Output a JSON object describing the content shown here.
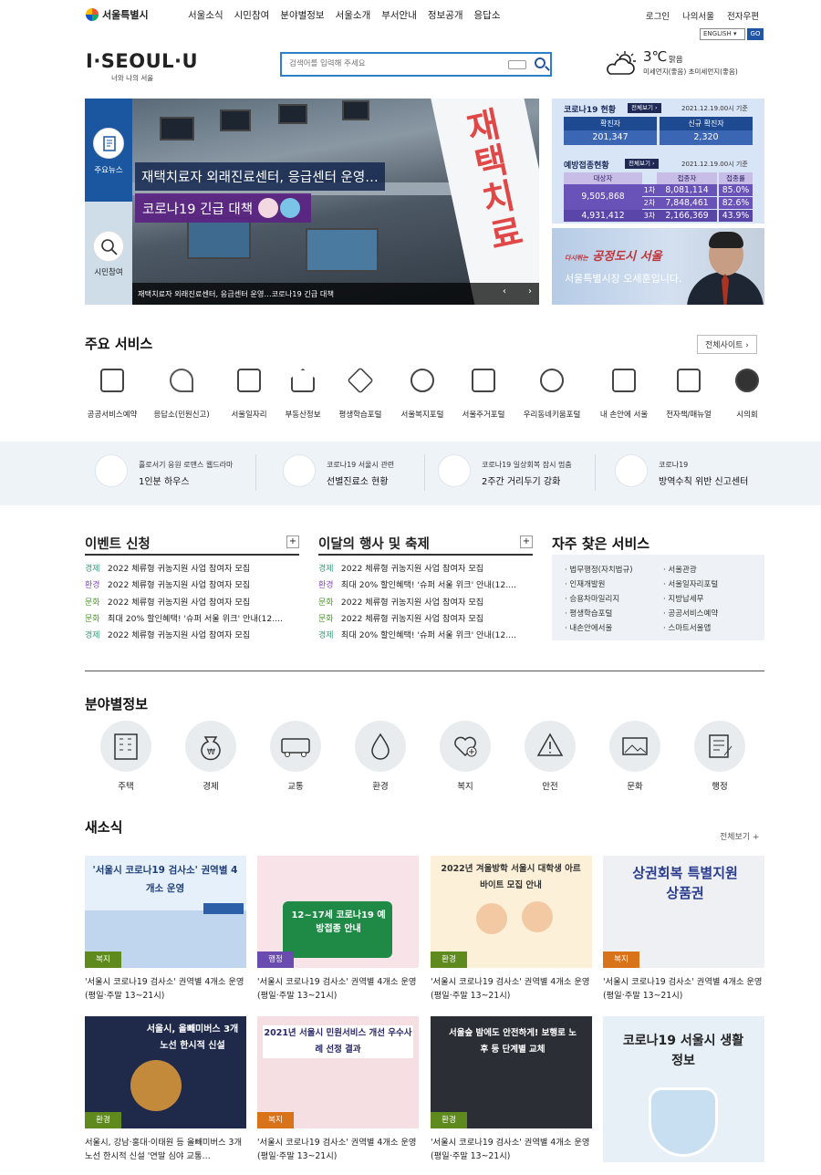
{
  "header": {
    "org_name": "서울특별시",
    "gnb": [
      "서울소식",
      "시민참여",
      "분야별정보",
      "서울소개",
      "부서안내",
      "정보공개",
      "응답소"
    ],
    "util": [
      "로그인",
      "나의서울",
      "전자우편"
    ],
    "language": "ENGLISH",
    "go_label": "GO",
    "brand": "I·SEOUL·U",
    "brand_sub": "너와 나의 서울",
    "search_placeholder": "검색어를 입력해 주세요",
    "weather": {
      "temp": "3℃",
      "desc": "맑음",
      "dust": "미세먼지(좋음) 초미세먼지(좋음)"
    }
  },
  "hero": {
    "side_news": "주요뉴스",
    "side_participation": "시민참여",
    "banner_text": "재택치료",
    "title1": "재택치료자 외래진료센터, 응급센터 운영…",
    "title2": "코로나19 긴급 대책",
    "caption": "재택치료자 외래진료센터, 응급센터 운영…코로나19 긴급 대책",
    "prev": "‹",
    "next": "›"
  },
  "covid": {
    "title": "코로나19 현황",
    "view_all": "전체보기 ›",
    "date": "2021.12.19.00시 기준",
    "confirmed_label": "확진자",
    "confirmed": "201,347",
    "new_label": "신규 확진자",
    "new_confirmed": "2,320",
    "vax_title": "예방접종현황",
    "vax_view_all": "전체보기 ›",
    "vax_date": "2021.12.19.00시 기준",
    "vax_headers": [
      "대상자",
      "접종자",
      "접종률"
    ],
    "target_1": "9,505,868",
    "target_2": "4,931,412",
    "rows": [
      {
        "dose": "1차",
        "count": "8,081,114",
        "rate": "85.0%"
      },
      {
        "dose": "2차",
        "count": "7,848,461",
        "rate": "82.6%"
      },
      {
        "dose": "3차",
        "count": "2,166,369",
        "rate": "43.9%"
      }
    ]
  },
  "mayor": {
    "slogan_small": "다시뛰는",
    "slogan": "공정도시 서울",
    "intro": "서울특별시장 오세훈입니다."
  },
  "services": {
    "title": "주요 서비스",
    "all_sites": "전체사이트 ›",
    "items": [
      "공공서비스예약",
      "응답소(민원신고)",
      "서울일자리",
      "부동산정보",
      "평생학습포털",
      "서울복지포털",
      "서울주거포털",
      "우리동네키움포털",
      "내 손안에 서울",
      "전자책/매뉴얼",
      "시의회"
    ]
  },
  "strip": [
    {
      "l1": "흘로서기 응원 로맨스 웹드라마",
      "l2": "1인분 하우스"
    },
    {
      "l1": "코로나19 서울시 관련",
      "l2": "선별진료소 현황"
    },
    {
      "l1": "코로나19 일상회복 잠시 멈춤",
      "l2": "2주간 거리두기 강화"
    },
    {
      "l1": "코로나19",
      "l2": "방역수칙 위반 신고센터"
    }
  ],
  "events": {
    "title": "이벤트 신청",
    "items": [
      {
        "cat": "경제",
        "text": "2022 체류형 귀농지원 사업 참여자 모집"
      },
      {
        "cat": "환경",
        "text": "2022 체류형 귀농지원 사업 참여자 모집"
      },
      {
        "cat": "문화",
        "text": "2022 체류형 귀농지원 사업 참여자 모집"
      },
      {
        "cat": "문화",
        "text": "최대 20% 할인혜택! '슈퍼 서울 위크' 안내(12...."
      },
      {
        "cat": "경제",
        "text": "2022 체류형 귀농지원 사업 참여자 모집"
      }
    ]
  },
  "festivals": {
    "title": "이달의 행사 및 축제",
    "items": [
      {
        "cat": "경제",
        "text": "2022 체류형 귀농지원 사업 참여자 모집"
      },
      {
        "cat": "환경",
        "text": "최대 20% 할인혜택! '슈퍼 서울 위크' 안내(12...."
      },
      {
        "cat": "문화",
        "text": "2022 체류형 귀농지원 사업 참여자 모집"
      },
      {
        "cat": "문화",
        "text": "2022 체류형 귀농지원 사업 참여자 모집"
      },
      {
        "cat": "경제",
        "text": "최대 20% 할인혜택! '슈퍼 서울 위크' 안내(12...."
      }
    ]
  },
  "faq": {
    "title": "자주 찾은 서비스",
    "left": [
      "법무행정(자치법규)",
      "인재개발원",
      "승용차마일리지",
      "평생학습포털",
      "내손안에서울"
    ],
    "right": [
      "서울관광",
      "서울일자리포털",
      "지방납세무",
      "공공서비스예약",
      "스마트서울맵"
    ]
  },
  "fields": {
    "title": "분야별정보",
    "items": [
      "주택",
      "경제",
      "교통",
      "환경",
      "복지",
      "안전",
      "문화",
      "행정"
    ]
  },
  "news": {
    "title": "새소식",
    "more": "전체보기 +",
    "cards": [
      {
        "tag": "복지",
        "img_text": "'서울시 코로나19 검사소' 권역별 4개소 운영",
        "caption": "'서울시 코로나19 검사소' 권역별 4개소 운영(평일·주말 13~21시)"
      },
      {
        "tag": "행정",
        "img_text": "12~17세 코로나19 예방접종 안내",
        "caption": "'서울시 코로나19 검사소' 권역별 4개소 운영(평일·주말 13~21시)"
      },
      {
        "tag": "환경",
        "img_text": "2022년 겨울방학 서울시 대학생 아르바이트 모집 안내",
        "caption": "'서울시 코로나19 검사소' 권역별 4개소 운영(평일·주말 13~21시)"
      },
      {
        "tag": "복지",
        "img_text": "상권회복 특별지원 상품권",
        "caption": "'서울시 코로나19 검사소' 권역별 4개소 운영(평일·주말 13~21시)"
      },
      {
        "tag": "환경",
        "img_text": "서울시, 올빼미버스 3개 노선 한시적 신설",
        "caption": "서울시, 강남·홍대·이태원 등 올빼미버스 3개 노선 한시적 신설 '연말 심야 교통…"
      },
      {
        "tag": "복지",
        "img_text": "2021년 서울시 민원서비스 개선 우수사례 선정 결과",
        "caption": "'서울시 코로나19 검사소' 권역별 4개소 운영(평일·주말 13~21시)"
      },
      {
        "tag": "환경",
        "img_text": "서울숲 밤에도 안전하게! 보행로 노후 등 단계별 교체",
        "caption": "'서울시 코로나19 검사소' 권역별 4개소 운영(평일·주말 13~21시)"
      },
      {
        "tag": "",
        "img_text": "코로나19 서울시 생활정보",
        "caption": ""
      }
    ]
  },
  "colors": {
    "brand_blue": "#1b56a1",
    "tag_olive": "#5f8a1e",
    "tag_orange": "#d8731a",
    "tag_purple": "#6a4bb0"
  }
}
